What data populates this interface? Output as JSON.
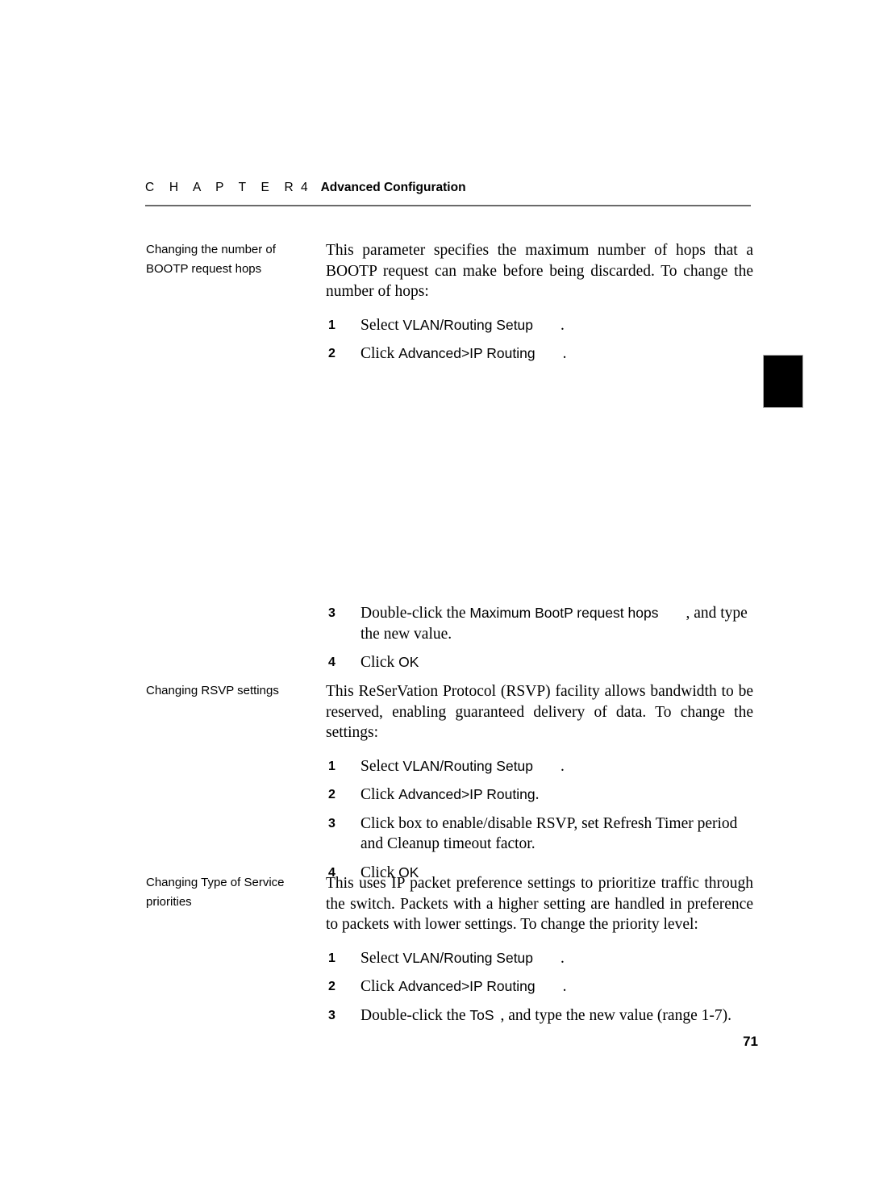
{
  "header": {
    "chapter_word": "C H A P T E R",
    "chapter_number": "4",
    "chapter_title": "Advanced Configuration"
  },
  "sections": [
    {
      "id": "bootp-hops",
      "side_label_line1": "Changing the number of",
      "side_label_line2": "BOOTP request hops",
      "paragraph": "This parameter specifies the maximum number of hops that a BOOTP request can make before being discarded. To change the number of hops:",
      "steps": [
        {
          "number": "1",
          "lead": "Select ",
          "ui": "VLAN/Routing Setup",
          "gap": "wide",
          "tail": "."
        },
        {
          "number": "2",
          "lead": "Click ",
          "ui": "Advanced>IP Routing",
          "gap": "wide",
          "tail": "."
        }
      ]
    },
    {
      "id": "bootp-hops-continued",
      "steps": [
        {
          "number": "3",
          "lead": "Double-click the ",
          "ui": "Maximum BootP request hops",
          "gap": "wide",
          "tail": ", and type the new value."
        },
        {
          "number": "4",
          "lead": "Click ",
          "ui": "OK",
          "gap": "none",
          "tail": ""
        }
      ]
    },
    {
      "id": "rsvp-settings",
      "side_label_line1": "Changing RSVP settings",
      "side_label_line2": "",
      "paragraph": "This ReSerVation Protocol (RSVP) facility allows bandwidth to be reserved, enabling guaranteed delivery of data. To change the settings:",
      "steps": [
        {
          "number": "1",
          "lead": "Select ",
          "ui": "VLAN/Routing Setup",
          "gap": "wide",
          "tail": "."
        },
        {
          "number": "2",
          "lead": "Click ",
          "ui": "Advanced>IP Routing",
          "gap": "none",
          "tail": "."
        },
        {
          "number": "3",
          "lead": "Click box to enable/disable RSVP, set Refresh Timer period and Cleanup timeout factor.",
          "ui": "",
          "gap": "none",
          "tail": ""
        },
        {
          "number": "4",
          "lead": "Click ",
          "ui": "OK",
          "gap": "none",
          "tail": ""
        }
      ]
    },
    {
      "id": "tos-priorities",
      "side_label_line1": "Changing Type of Service",
      "side_label_line2": "priorities",
      "paragraph": "This uses IP packet preference settings to prioritize traffic through the switch. Packets with a higher setting are handled in preference to packets with lower settings. To change the priority level:",
      "steps": [
        {
          "number": "1",
          "lead": "Select ",
          "ui": "VLAN/Routing Setup",
          "gap": "wide",
          "tail": "."
        },
        {
          "number": "2",
          "lead": "Click ",
          "ui": "Advanced>IP Routing",
          "gap": "wide",
          "tail": "."
        },
        {
          "number": "3",
          "lead": "Double-click the ",
          "ui": "ToS",
          "gap": "small",
          "tail": ", and type the new value (range 1-7)."
        }
      ]
    }
  ],
  "thumb_tab": {
    "color": "#000000"
  },
  "folio": {
    "page_number": "71"
  }
}
